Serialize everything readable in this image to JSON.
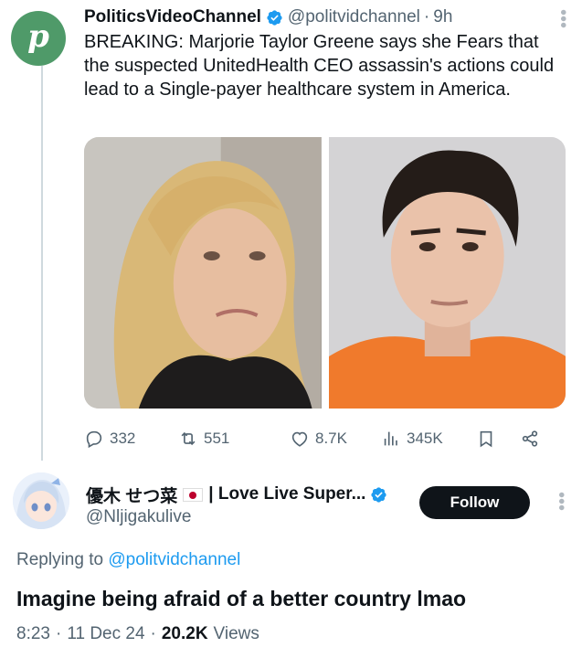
{
  "tweet": {
    "avatar_letter": "p",
    "display_name": "PoliticsVideoChannel",
    "handle": "@politvidchannel",
    "separator": "·",
    "time": "9h",
    "text": "BREAKING: Marjorie Taylor Greene says she Fears that the suspected UnitedHealth CEO assassin's actions could lead to a Single-payer healthcare system in America.",
    "media": [
      {
        "description_icon": "photo-woman-blonde"
      },
      {
        "description_icon": "photo-man-curly-hair-orange-shirt"
      }
    ],
    "actions": {
      "replies": "332",
      "reposts": "551",
      "likes": "8.7K",
      "views": "345K"
    }
  },
  "reply": {
    "display_name": "優木 せつ菜",
    "display_name_suffix": "| Love Live Super...",
    "handle": "@Nljigakulive",
    "follow_label": "Follow",
    "replying_to_prefix": "Replying to",
    "replying_to_handle": "@politvidchannel",
    "text": "Imagine being afraid of a better country lmao",
    "time": "8:23",
    "date": "11 Dec 24",
    "views_count": "20.2K",
    "views_label": "Views",
    "dot": "·"
  },
  "colors": {
    "brand_green": "#4f9a69",
    "verified_blue": "#1d9bf0",
    "secondary_text": "#536471",
    "primary_text": "#0f1419",
    "follow_bg": "#0f1419",
    "flag_red": "#bc002d"
  }
}
